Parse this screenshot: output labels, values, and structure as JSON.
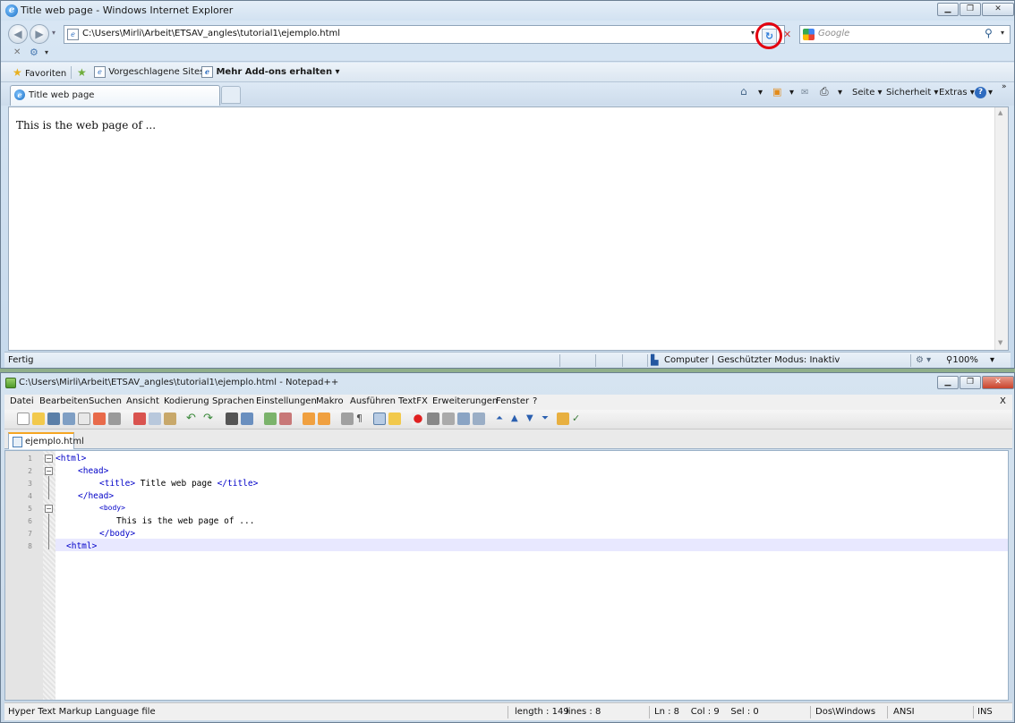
{
  "ie": {
    "title": "Title web page - Windows Internet Explorer",
    "address": "C:\\Users\\Mirli\\Arbeit\\ETSAV_angles\\tutorial1\\ejemplo.html",
    "search_placeholder": "Google",
    "favorites": {
      "favoriten": "Favoriten",
      "suggested": "Vorgeschlagene Sites",
      "addons": "Mehr Add-ons erhalten"
    },
    "tab_title": "Title web page",
    "tools": {
      "seite": "Seite",
      "sicherheit": "Sicherheit",
      "extras": "Extras"
    },
    "page_text": "This is the web page of ...",
    "status": {
      "left": "Fertig",
      "zone": "Computer | Geschützter Modus: Inaktiv",
      "zoom": "100%"
    }
  },
  "npp": {
    "title": "C:\\Users\\Mirli\\Arbeit\\ETSAV_angles\\tutorial1\\ejemplo.html - Notepad++",
    "menu": [
      "Datei",
      "Bearbeiten",
      "Suchen",
      "Ansicht",
      "Kodierung",
      "Sprachen",
      "Einstellungen",
      "Makro",
      "Ausführen",
      "TextFX",
      "Erweiterungen",
      "Fenster",
      "?"
    ],
    "menu_close": "X",
    "tab_label": "ejemplo.html",
    "line_numbers": [
      "1",
      "2",
      "3",
      "4",
      "5",
      "6",
      "7",
      "8"
    ],
    "code": {
      "l1": "<html>",
      "l2": "<head>",
      "l3_open": "<title>",
      "l3_text": " Title web page ",
      "l3_close": "</title>",
      "l4": "</head>",
      "l5": "<body>",
      "l6": "This is the web page of ...",
      "l7": "</body>",
      "l8": "<html>"
    },
    "status": {
      "filetype": "Hyper Text Markup Language file",
      "length": "length : 149",
      "lines": "lines : 8",
      "pos": "Ln : 8    Col : 9    Sel : 0",
      "eol": "Dos\\Windows",
      "encoding": "ANSI",
      "mode": "INS"
    }
  },
  "colors": {
    "highlight_circle": "#e3000f",
    "tag_blue": "#0000c8",
    "current_line": "#e8e8ff"
  }
}
